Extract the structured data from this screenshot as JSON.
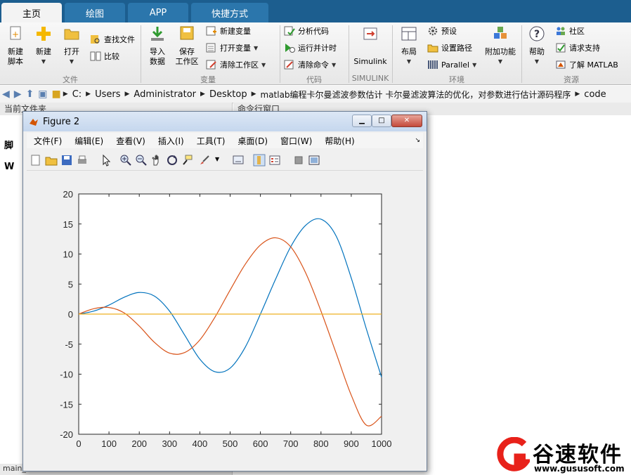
{
  "tabs": [
    "主页",
    "绘图",
    "APP",
    "快捷方式"
  ],
  "ribbon": {
    "file": {
      "new_script": "新建\n脚本",
      "new": "新建",
      "open": "打开",
      "find_files": "查找文件",
      "compare": "比较",
      "group": "文件"
    },
    "variable": {
      "import": "导入\n数据",
      "save_ws": "保存\n工作区",
      "new_var": "新建变量",
      "open_var": "打开变量",
      "clear_ws": "清除工作区",
      "group": "变量"
    },
    "code": {
      "analyze": "分析代码",
      "run_time": "运行并计时",
      "clear_cmd": "清除命令",
      "group": "代码"
    },
    "simulink": {
      "label": "Simulink",
      "group": "SIMULINK"
    },
    "environment": {
      "layout": "布局",
      "prefs": "预设",
      "set_path": "设置路径",
      "parallel": "Parallel",
      "addons": "附加功能",
      "group": "环境"
    },
    "resources": {
      "help": "帮助",
      "community": "社区",
      "support": "请求支持",
      "learn": "了解 MATLAB",
      "group": "资源"
    }
  },
  "address": {
    "crumbs": [
      "C:",
      "Users",
      "Administrator",
      "Desktop",
      "matlab编程卡尔曼滤波参数估计 卡尔曼滤波算法的优化，对参数进行估计源码程序",
      "code"
    ]
  },
  "panels": {
    "current_folder": "当前文件夹",
    "command_window": "命令行窗口",
    "status_left": "main_...",
    "left_item1": "脚",
    "left_item2": "W"
  },
  "figure": {
    "title": "Figure 2",
    "menu": [
      "文件(F)",
      "编辑(E)",
      "查看(V)",
      "插入(I)",
      "工具(T)",
      "桌面(D)",
      "窗口(W)",
      "帮助(H)"
    ]
  },
  "chart_data": {
    "type": "line",
    "title": "",
    "xlabel": "",
    "ylabel": "",
    "xlim": [
      0,
      1000
    ],
    "ylim": [
      -20,
      20
    ],
    "xticks": [
      0,
      100,
      200,
      300,
      400,
      500,
      600,
      700,
      800,
      900,
      1000
    ],
    "yticks": [
      -20,
      -15,
      -10,
      -5,
      0,
      5,
      10,
      15,
      20
    ],
    "grid": false,
    "x": [
      0,
      50,
      100,
      150,
      200,
      250,
      300,
      350,
      400,
      450,
      500,
      550,
      600,
      650,
      700,
      750,
      800,
      850,
      900,
      950,
      1000
    ],
    "series": [
      {
        "color": "#0072bd",
        "values": [
          0,
          0.5,
          1.5,
          2.8,
          3.6,
          3.0,
          0.5,
          -3.5,
          -7.5,
          -9.6,
          -9.0,
          -5.5,
          0,
          5.8,
          11.2,
          14.8,
          15.8,
          13.0,
          6.0,
          -2.5,
          -10.5
        ]
      },
      {
        "color": "#d95319",
        "values": [
          0,
          0.9,
          1.1,
          0.2,
          -2.0,
          -4.7,
          -6.5,
          -6.4,
          -4.3,
          -0.5,
          4.0,
          8.3,
          11.5,
          12.7,
          11.2,
          6.8,
          0.5,
          -6.5,
          -13.5,
          -18.5,
          -17.0
        ]
      },
      {
        "color": "#edb120",
        "values": [
          0,
          0,
          0,
          0,
          0,
          0,
          0,
          0,
          0,
          0,
          0,
          0,
          0,
          0,
          0,
          0,
          0,
          0,
          0,
          0,
          0
        ]
      }
    ]
  },
  "watermark": {
    "brand": "谷速软件",
    "url": "www.gususoft.com",
    "color": "#e8211a"
  }
}
